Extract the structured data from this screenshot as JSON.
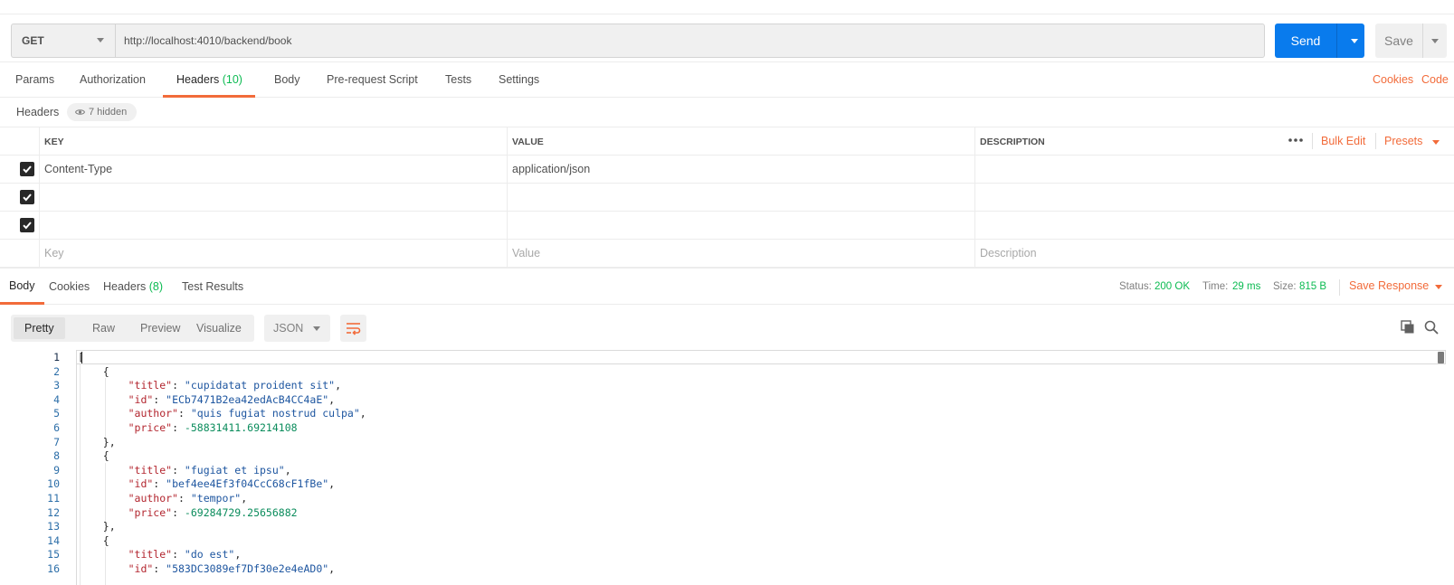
{
  "request": {
    "method": "GET",
    "url": "http://localhost:4010/backend/book",
    "send_label": "Send",
    "save_label": "Save"
  },
  "request_tabs": {
    "params": "Params",
    "authorization": "Authorization",
    "headers": "Headers",
    "headers_count": "(10)",
    "body": "Body",
    "pre_request_script": "Pre-request Script",
    "tests": "Tests",
    "settings": "Settings",
    "cookies_link": "Cookies",
    "code_link": "Code"
  },
  "headers_section": {
    "title": "Headers",
    "hidden_label": "7 hidden",
    "columns": {
      "key": "KEY",
      "value": "VALUE",
      "description": "DESCRIPTION"
    },
    "bulk_edit": "Bulk Edit",
    "presets": "Presets",
    "rows": [
      {
        "checked": true,
        "key": "Content-Type",
        "value": "application/json",
        "description": ""
      },
      {
        "checked": true,
        "key": "",
        "value": "",
        "description": ""
      },
      {
        "checked": true,
        "key": "",
        "value": "",
        "description": ""
      }
    ],
    "placeholders": {
      "key": "Key",
      "value": "Value",
      "description": "Description"
    }
  },
  "response_tabs": {
    "body": "Body",
    "cookies": "Cookies",
    "headers": "Headers",
    "headers_count": "(8)",
    "test_results": "Test Results"
  },
  "response_status": {
    "status_label": "Status:",
    "status_value": "200 OK",
    "time_label": "Time:",
    "time_value": "29 ms",
    "size_label": "Size:",
    "size_value": "815 B",
    "save_response": "Save Response"
  },
  "response_view": {
    "modes": [
      "Pretty",
      "Raw",
      "Preview",
      "Visualize"
    ],
    "active_mode": "Pretty",
    "format": "JSON"
  },
  "code_lines": [
    {
      "n": "1",
      "indent": 0,
      "parts": [
        [
          "p",
          "["
        ]
      ]
    },
    {
      "n": "2",
      "indent": 1,
      "parts": [
        [
          "p",
          "{"
        ]
      ]
    },
    {
      "n": "3",
      "indent": 2,
      "parts": [
        [
          "k",
          "\"title\""
        ],
        [
          "p",
          ": "
        ],
        [
          "s",
          "\"cupidatat proident sit\""
        ],
        [
          "p",
          ","
        ]
      ]
    },
    {
      "n": "4",
      "indent": 2,
      "parts": [
        [
          "k",
          "\"id\""
        ],
        [
          "p",
          ": "
        ],
        [
          "s",
          "\"ECb7471B2ea42edAcB4CC4aE\""
        ],
        [
          "p",
          ","
        ]
      ]
    },
    {
      "n": "5",
      "indent": 2,
      "parts": [
        [
          "k",
          "\"author\""
        ],
        [
          "p",
          ": "
        ],
        [
          "s",
          "\"quis fugiat nostrud culpa\""
        ],
        [
          "p",
          ","
        ]
      ]
    },
    {
      "n": "6",
      "indent": 2,
      "parts": [
        [
          "k",
          "\"price\""
        ],
        [
          "p",
          ": "
        ],
        [
          "n",
          "-58831411.69214108"
        ]
      ]
    },
    {
      "n": "7",
      "indent": 1,
      "parts": [
        [
          "p",
          "},"
        ]
      ]
    },
    {
      "n": "8",
      "indent": 1,
      "parts": [
        [
          "p",
          "{"
        ]
      ]
    },
    {
      "n": "9",
      "indent": 2,
      "parts": [
        [
          "k",
          "\"title\""
        ],
        [
          "p",
          ": "
        ],
        [
          "s",
          "\"fugiat et ipsu\""
        ],
        [
          "p",
          ","
        ]
      ]
    },
    {
      "n": "10",
      "indent": 2,
      "parts": [
        [
          "k",
          "\"id\""
        ],
        [
          "p",
          ": "
        ],
        [
          "s",
          "\"bef4ee4Ef3f04CcC68cF1fBe\""
        ],
        [
          "p",
          ","
        ]
      ]
    },
    {
      "n": "11",
      "indent": 2,
      "parts": [
        [
          "k",
          "\"author\""
        ],
        [
          "p",
          ": "
        ],
        [
          "s",
          "\"tempor\""
        ],
        [
          "p",
          ","
        ]
      ]
    },
    {
      "n": "12",
      "indent": 2,
      "parts": [
        [
          "k",
          "\"price\""
        ],
        [
          "p",
          ": "
        ],
        [
          "n",
          "-69284729.25656882"
        ]
      ]
    },
    {
      "n": "13",
      "indent": 1,
      "parts": [
        [
          "p",
          "},"
        ]
      ]
    },
    {
      "n": "14",
      "indent": 1,
      "parts": [
        [
          "p",
          "{"
        ]
      ]
    },
    {
      "n": "15",
      "indent": 2,
      "parts": [
        [
          "k",
          "\"title\""
        ],
        [
          "p",
          ": "
        ],
        [
          "s",
          "\"do est\""
        ],
        [
          "p",
          ","
        ]
      ]
    },
    {
      "n": "16",
      "indent": 2,
      "parts": [
        [
          "k",
          "\"id\""
        ],
        [
          "p",
          ": "
        ],
        [
          "s",
          "\"583DC3089ef7Df30e2e4eAD0\""
        ],
        [
          "p",
          ","
        ]
      ]
    }
  ],
  "colors": {
    "accent": "#f26b3a",
    "send_blue": "#097bed",
    "success_green": "#0cbb52",
    "json_key": "#b3262f",
    "json_string": "#1e56a0",
    "json_number": "#0b8c5c"
  },
  "icons": [
    "caret-down-icon",
    "eye-icon",
    "checkbox-checked-icon",
    "more-dots-icon",
    "wrap-lines-icon",
    "copy-icon",
    "search-icon"
  ]
}
